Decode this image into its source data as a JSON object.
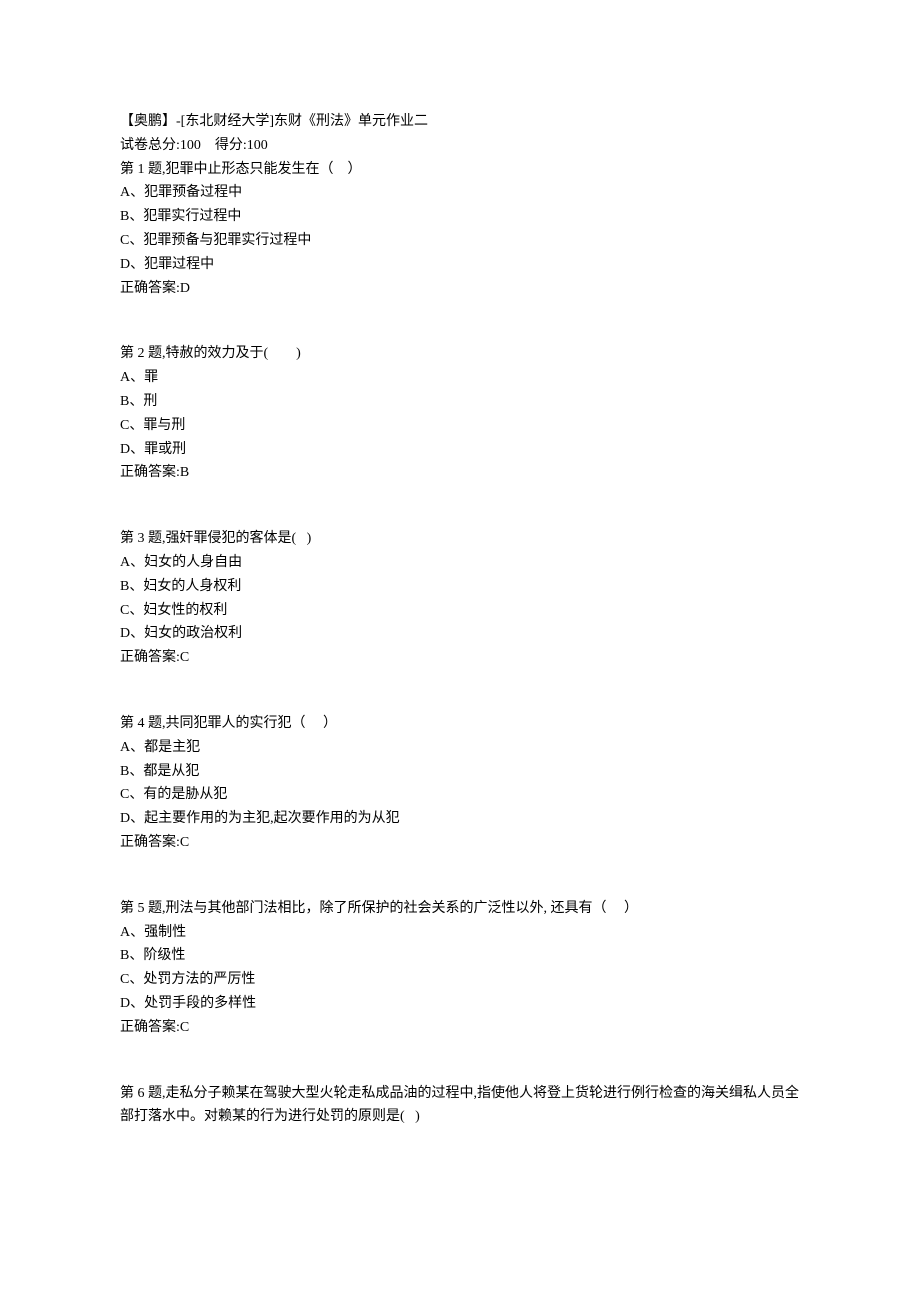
{
  "header": {
    "title": "【奥鹏】-[东北财经大学]东财《刑法》单元作业二",
    "score_line": "试卷总分:100    得分:100"
  },
  "questions": [
    {
      "stem": "第 1 题,犯罪中止形态只能发生在（    ）",
      "options": [
        "A、犯罪预备过程中",
        "B、犯罪实行过程中",
        "C、犯罪预备与犯罪实行过程中",
        "D、犯罪过程中"
      ],
      "answer": "正确答案:D"
    },
    {
      "stem": "第 2 题,特赦的效力及于(        )",
      "options": [
        "A、罪",
        "B、刑",
        "C、罪与刑",
        "D、罪或刑"
      ],
      "answer": "正确答案:B"
    },
    {
      "stem": "第 3 题,强奸罪侵犯的客体是(   )",
      "options": [
        "A、妇女的人身自由",
        "B、妇女的人身权利",
        "C、妇女性的权利",
        "D、妇女的政治权利"
      ],
      "answer": "正确答案:C"
    },
    {
      "stem": "第 4 题,共同犯罪人的实行犯（     ）",
      "options": [
        "A、都是主犯",
        "B、都是从犯",
        "C、有的是胁从犯",
        "D、起主要作用的为主犯,起次要作用的为从犯"
      ],
      "answer": "正确答案:C"
    },
    {
      "stem": "第 5 题,刑法与其他部门法相比，除了所保护的社会关系的广泛性以外, 还具有（     ）",
      "options": [
        "A、强制性",
        "B、阶级性",
        "C、处罚方法的严厉性",
        "D、处罚手段的多样性"
      ],
      "answer": "正确答案:C"
    },
    {
      "stem": "第 6 题,走私分子赖某在驾驶大型火轮走私成品油的过程中,指使他人将登上货轮进行例行检查的海关缉私人员全部打落水中。对赖某的行为进行处罚的原则是(   )",
      "options": [],
      "answer": ""
    }
  ]
}
